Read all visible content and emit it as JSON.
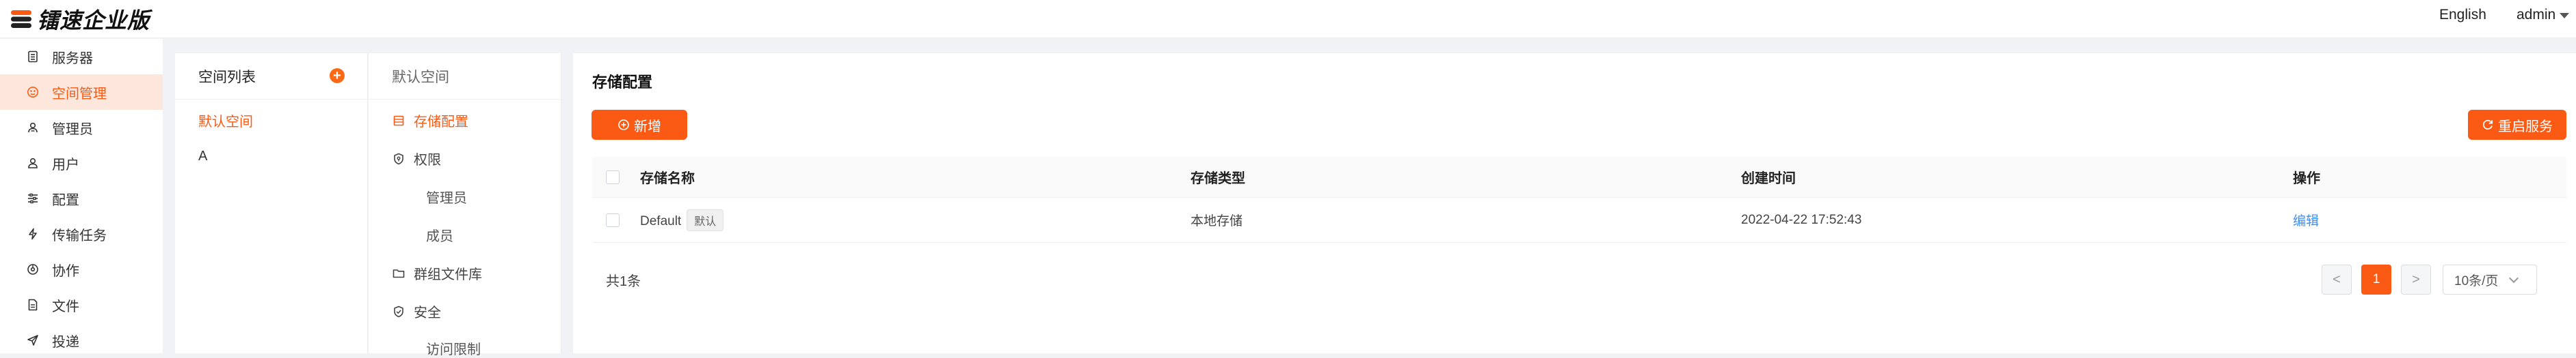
{
  "app": {
    "logo_text": "镭速企业版",
    "language": "English",
    "user": "admin"
  },
  "sidebar": {
    "items": [
      {
        "label": "服务器",
        "icon": "server-icon"
      },
      {
        "label": "空间管理",
        "icon": "space-icon",
        "active": true
      },
      {
        "label": "管理员",
        "icon": "admin-icon"
      },
      {
        "label": "用户",
        "icon": "user-icon"
      },
      {
        "label": "配置",
        "icon": "settings-sliders-icon"
      },
      {
        "label": "传输任务",
        "icon": "transfer-icon"
      },
      {
        "label": "协作",
        "icon": "collaborate-icon"
      },
      {
        "label": "文件",
        "icon": "file-icon"
      },
      {
        "label": "投递",
        "icon": "send-icon"
      }
    ]
  },
  "spaces": {
    "title": "空间列表",
    "add_symbol": "+",
    "items": [
      {
        "label": "默认空间",
        "active": true
      },
      {
        "label": "A"
      }
    ]
  },
  "space_menu": {
    "title": "默认空间",
    "items": [
      {
        "label": "存储配置",
        "icon": "storage-icon",
        "active": true
      },
      {
        "label": "权限",
        "icon": "permission-icon"
      },
      {
        "label": "管理员",
        "sub": true
      },
      {
        "label": "成员",
        "sub": true
      },
      {
        "label": "群组文件库",
        "icon": "folder-icon"
      },
      {
        "label": "安全",
        "icon": "shield-icon"
      },
      {
        "label": "访问限制",
        "sub": true
      }
    ]
  },
  "main": {
    "title": "存储配置",
    "add_button": "新增",
    "restart_button": "重启服务",
    "table": {
      "headers": [
        "存储名称",
        "存储类型",
        "创建时间",
        "操作"
      ],
      "rows": [
        {
          "name": "Default",
          "tag": "默认",
          "type": "本地存储",
          "created": "2022-04-22 17:52:43",
          "action": "编辑"
        }
      ]
    },
    "total": "共1条",
    "pagination": {
      "prev": "<",
      "current": "1",
      "next": ">",
      "page_size": "10条/页"
    }
  },
  "colors": {
    "accent": "#fa5a14",
    "link": "#3b8ff3",
    "active_bg": "#fde7dc"
  }
}
